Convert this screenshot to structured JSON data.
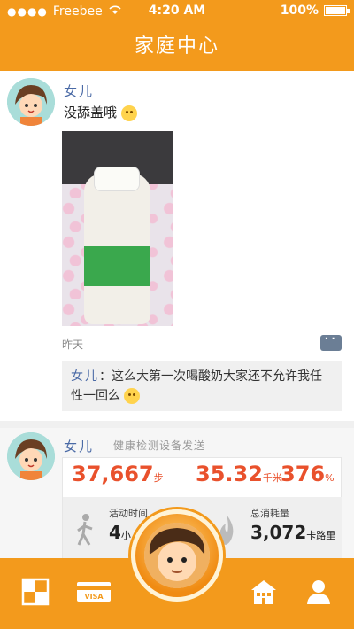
{
  "status_bar": {
    "signal_dots": "●●●●",
    "carrier": "Freebee",
    "time": "4:20 AM",
    "battery": "100%"
  },
  "header": {
    "title": "家庭中心"
  },
  "post1": {
    "author": "女儿",
    "text": "没舔盖哦",
    "date": "昨天",
    "reply": {
      "author": "女儿",
      "text": "这么大第一次喝酸奶大家还不允许我任性一回么"
    }
  },
  "post2": {
    "author": "女儿",
    "source": "健康检测设备发送",
    "steps": "37,667",
    "steps_unit": "步",
    "distance": "35.32",
    "distance_unit": "千米",
    "percent": "376",
    "percent_unit": "%",
    "active_time_label": "活动时间",
    "active_time_value": "4",
    "active_time_unit": "小",
    "calories_label": "总消耗量",
    "calories_value": "3,072",
    "calories_unit": "卡路里"
  },
  "tabbar": {
    "tabs": [
      "checker-icon",
      "visa-card-icon",
      "home-icon",
      "user-icon"
    ],
    "card_text": "VISA"
  },
  "colors": {
    "brand": "#f39a1c",
    "accent": "#e9512c",
    "name": "#4a6aa6"
  }
}
